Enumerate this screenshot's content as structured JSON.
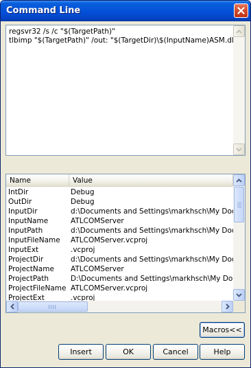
{
  "window": {
    "title": "Command Line"
  },
  "command": {
    "text": "regsvr32 /s /c \"$(TargetPath)\"\ntlbimp \"$(TargetPath)\" /out: \"$(TargetDir)\\$(InputName)ASM.dll\""
  },
  "macros_list": {
    "columns": [
      "Name",
      "Value"
    ],
    "rows": [
      {
        "name": "IntDir",
        "value": "Debug"
      },
      {
        "name": "OutDir",
        "value": "Debug"
      },
      {
        "name": "InputDir",
        "value": "d:\\Documents and Settings\\markhsch\\My Docume"
      },
      {
        "name": "InputName",
        "value": "ATLCOMServer"
      },
      {
        "name": "InputPath",
        "value": "d:\\Documents and Settings\\markhsch\\My Docume"
      },
      {
        "name": "InputFileName",
        "value": "ATLCOMServer.vcproj"
      },
      {
        "name": "InputExt",
        "value": ".vcproj"
      },
      {
        "name": "ProjectDir",
        "value": "d:\\Documents and Settings\\markhsch\\My Docume"
      },
      {
        "name": "ProjectName",
        "value": "ATLCOMServer"
      },
      {
        "name": "ProjectPath",
        "value": "D:\\Documents and Settings\\markhsch\\My Docume"
      },
      {
        "name": "ProjectFileName",
        "value": "ATLCOMServer.vcproj"
      },
      {
        "name": "ProjectExt",
        "value": ".vcproj"
      }
    ]
  },
  "buttons": {
    "macros": "Macros<<",
    "insert": "Insert",
    "ok": "OK",
    "cancel": "Cancel",
    "help": "Help"
  },
  "colors": {
    "title_bar": "#0450d8",
    "close_button": "#d14a2a",
    "dialog_face": "#ece9d8"
  }
}
